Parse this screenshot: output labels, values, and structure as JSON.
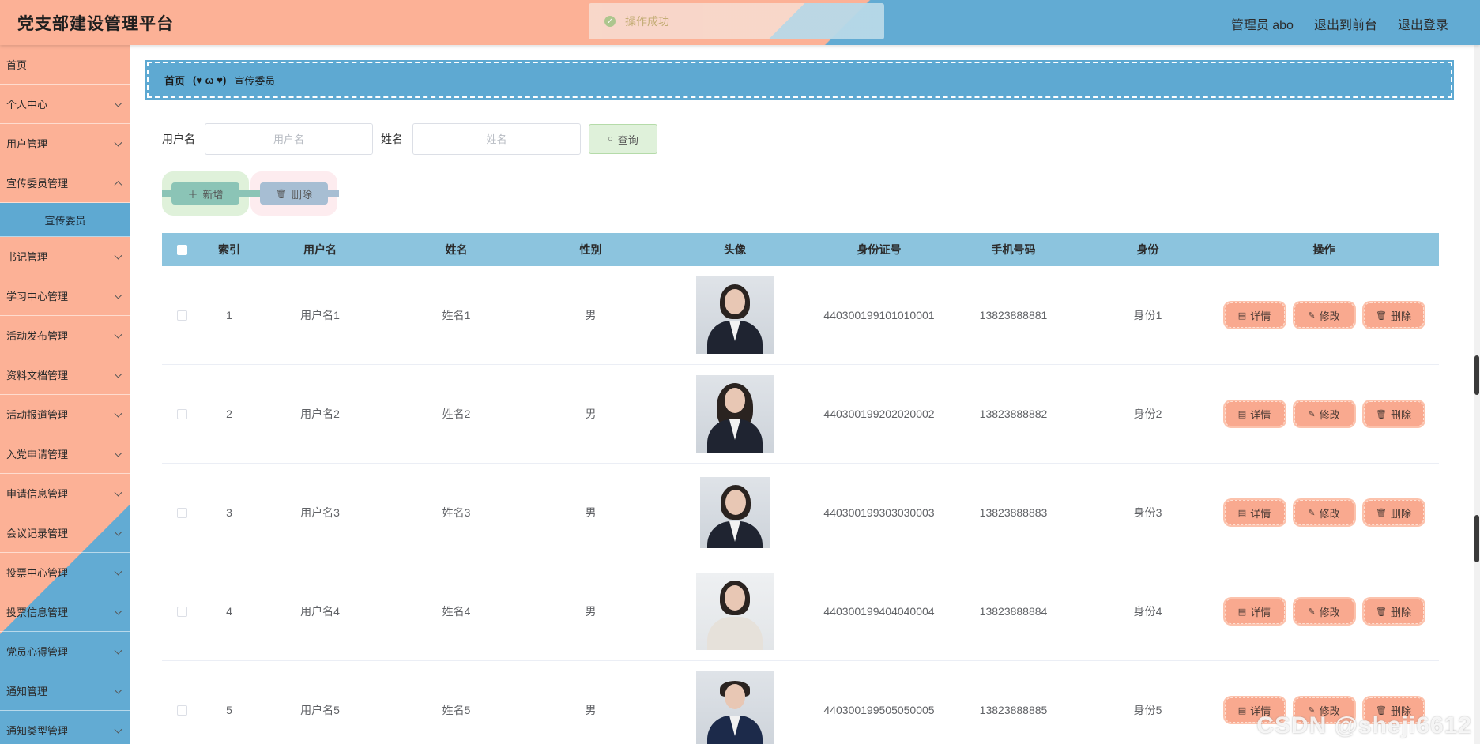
{
  "header": {
    "title": "党支部建设管理平台",
    "admin": "管理员 abo",
    "front": "退出到前台",
    "logout": "退出登录"
  },
  "toast": {
    "message": "操作成功"
  },
  "sidebar": {
    "items": [
      {
        "label": "首页"
      },
      {
        "label": "个人中心"
      },
      {
        "label": "用户管理"
      },
      {
        "label": "宣传委员管理"
      },
      {
        "label": "宣传委员"
      },
      {
        "label": "书记管理"
      },
      {
        "label": "学习中心管理"
      },
      {
        "label": "活动发布管理"
      },
      {
        "label": "资料文档管理"
      },
      {
        "label": "活动报道管理"
      },
      {
        "label": "入党申请管理"
      },
      {
        "label": "申请信息管理"
      },
      {
        "label": "会议记录管理"
      },
      {
        "label": "投票中心管理"
      },
      {
        "label": "投票信息管理"
      },
      {
        "label": "党员心得管理"
      },
      {
        "label": "通知管理"
      },
      {
        "label": "通知类型管理"
      }
    ]
  },
  "breadcrumb": {
    "home": "首页",
    "sep": "(♥ ω ♥)",
    "current": "宣传委员"
  },
  "search": {
    "username_label": "用户名",
    "username_placeholder": "用户名",
    "name_label": "姓名",
    "name_placeholder": "姓名",
    "query_label": "查询"
  },
  "actions": {
    "add_label": "新增",
    "delete_label": "删除"
  },
  "table": {
    "headers": [
      "索引",
      "用户名",
      "姓名",
      "性别",
      "头像",
      "身份证号",
      "手机号码",
      "身份",
      "操作"
    ],
    "ops": {
      "detail": "详情",
      "edit": "修改",
      "delete": "删除"
    },
    "rows": [
      {
        "index": "1",
        "username": "用户名1",
        "name": "姓名1",
        "sex": "男",
        "idcard": "440300199101010001",
        "phone": "13823888881",
        "role": "身份1"
      },
      {
        "index": "2",
        "username": "用户名2",
        "name": "姓名2",
        "sex": "男",
        "idcard": "440300199202020002",
        "phone": "13823888882",
        "role": "身份2"
      },
      {
        "index": "3",
        "username": "用户名3",
        "name": "姓名3",
        "sex": "男",
        "idcard": "440300199303030003",
        "phone": "13823888883",
        "role": "身份3"
      },
      {
        "index": "4",
        "username": "用户名4",
        "name": "姓名4",
        "sex": "男",
        "idcard": "440300199404040004",
        "phone": "13823888884",
        "role": "身份4"
      },
      {
        "index": "5",
        "username": "用户名5",
        "name": "姓名5",
        "sex": "男",
        "idcard": "440300199505050005",
        "phone": "13823888885",
        "role": "身份5"
      }
    ]
  },
  "watermark": "CSDN @sheji6612",
  "colors": {
    "peach": "#fcb196",
    "blue": "#62abd3",
    "header_blue": "#8cc4de",
    "op_button": "#f9a98f"
  }
}
